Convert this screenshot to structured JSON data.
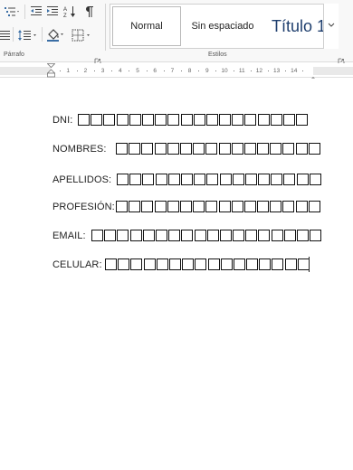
{
  "ribbon": {
    "paragraph_group_label": "Párrafo",
    "styles_group_label": "Estilos",
    "styles": {
      "normal": "Normal",
      "no_spacing": "Sin espaciado",
      "heading1": "Título 1"
    }
  },
  "ruler": {
    "numbers": [
      "1",
      "2",
      "3",
      "4",
      "5",
      "6",
      "7",
      "8",
      "9",
      "10",
      "11",
      "12",
      "13",
      "14"
    ]
  },
  "document": {
    "fields": [
      {
        "label": "DNI:",
        "boxes": 18
      },
      {
        "label": "NOMBRES:",
        "boxes": 16
      },
      {
        "label": "APELLIDOS:",
        "boxes": 16
      },
      {
        "label": "PROFESIÓN:",
        "boxes": 16
      },
      {
        "label": "EMAIL:",
        "boxes": 18
      },
      {
        "label": "CELULAR:",
        "boxes": 16
      }
    ]
  }
}
